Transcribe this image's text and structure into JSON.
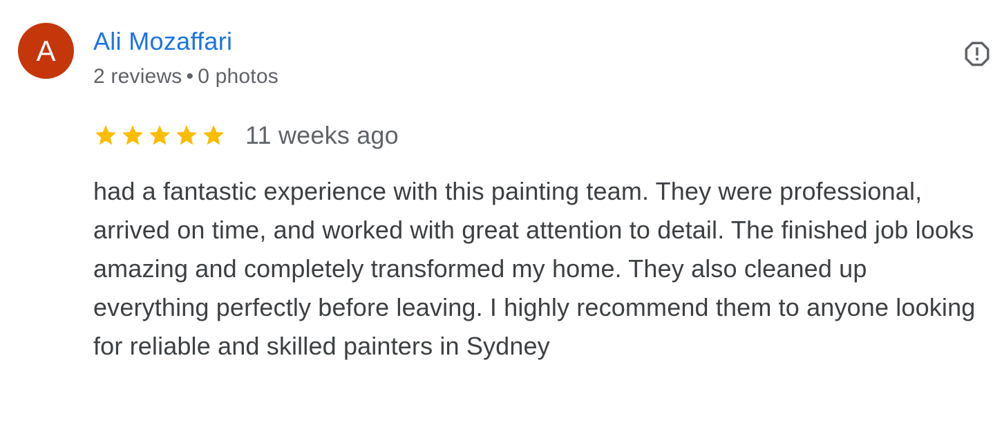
{
  "reviewer": {
    "initial": "A",
    "name": "Ali Mozaffari",
    "reviews_count": "2 reviews",
    "separator": "•",
    "photos_count": "0 photos",
    "avatar_color": "#c5360b"
  },
  "review": {
    "rating": 5,
    "max_rating": 5,
    "date": "11 weeks ago",
    "text": "had a fantastic experience with this painting team. They were professional, arrived on time, and worked with great attention to detail. The finished job looks amazing and completely transformed my home. They also cleaned up everything perfectly before leaving. I highly recommend them to anyone looking for reliable and skilled painters in Sydney"
  },
  "icons": {
    "report": "report-flag-icon",
    "star": "star-icon"
  },
  "colors": {
    "name_link": "#1a73e8",
    "star": "#fbbc04",
    "meta_text": "#5f6368",
    "body_text": "#3c4043"
  }
}
